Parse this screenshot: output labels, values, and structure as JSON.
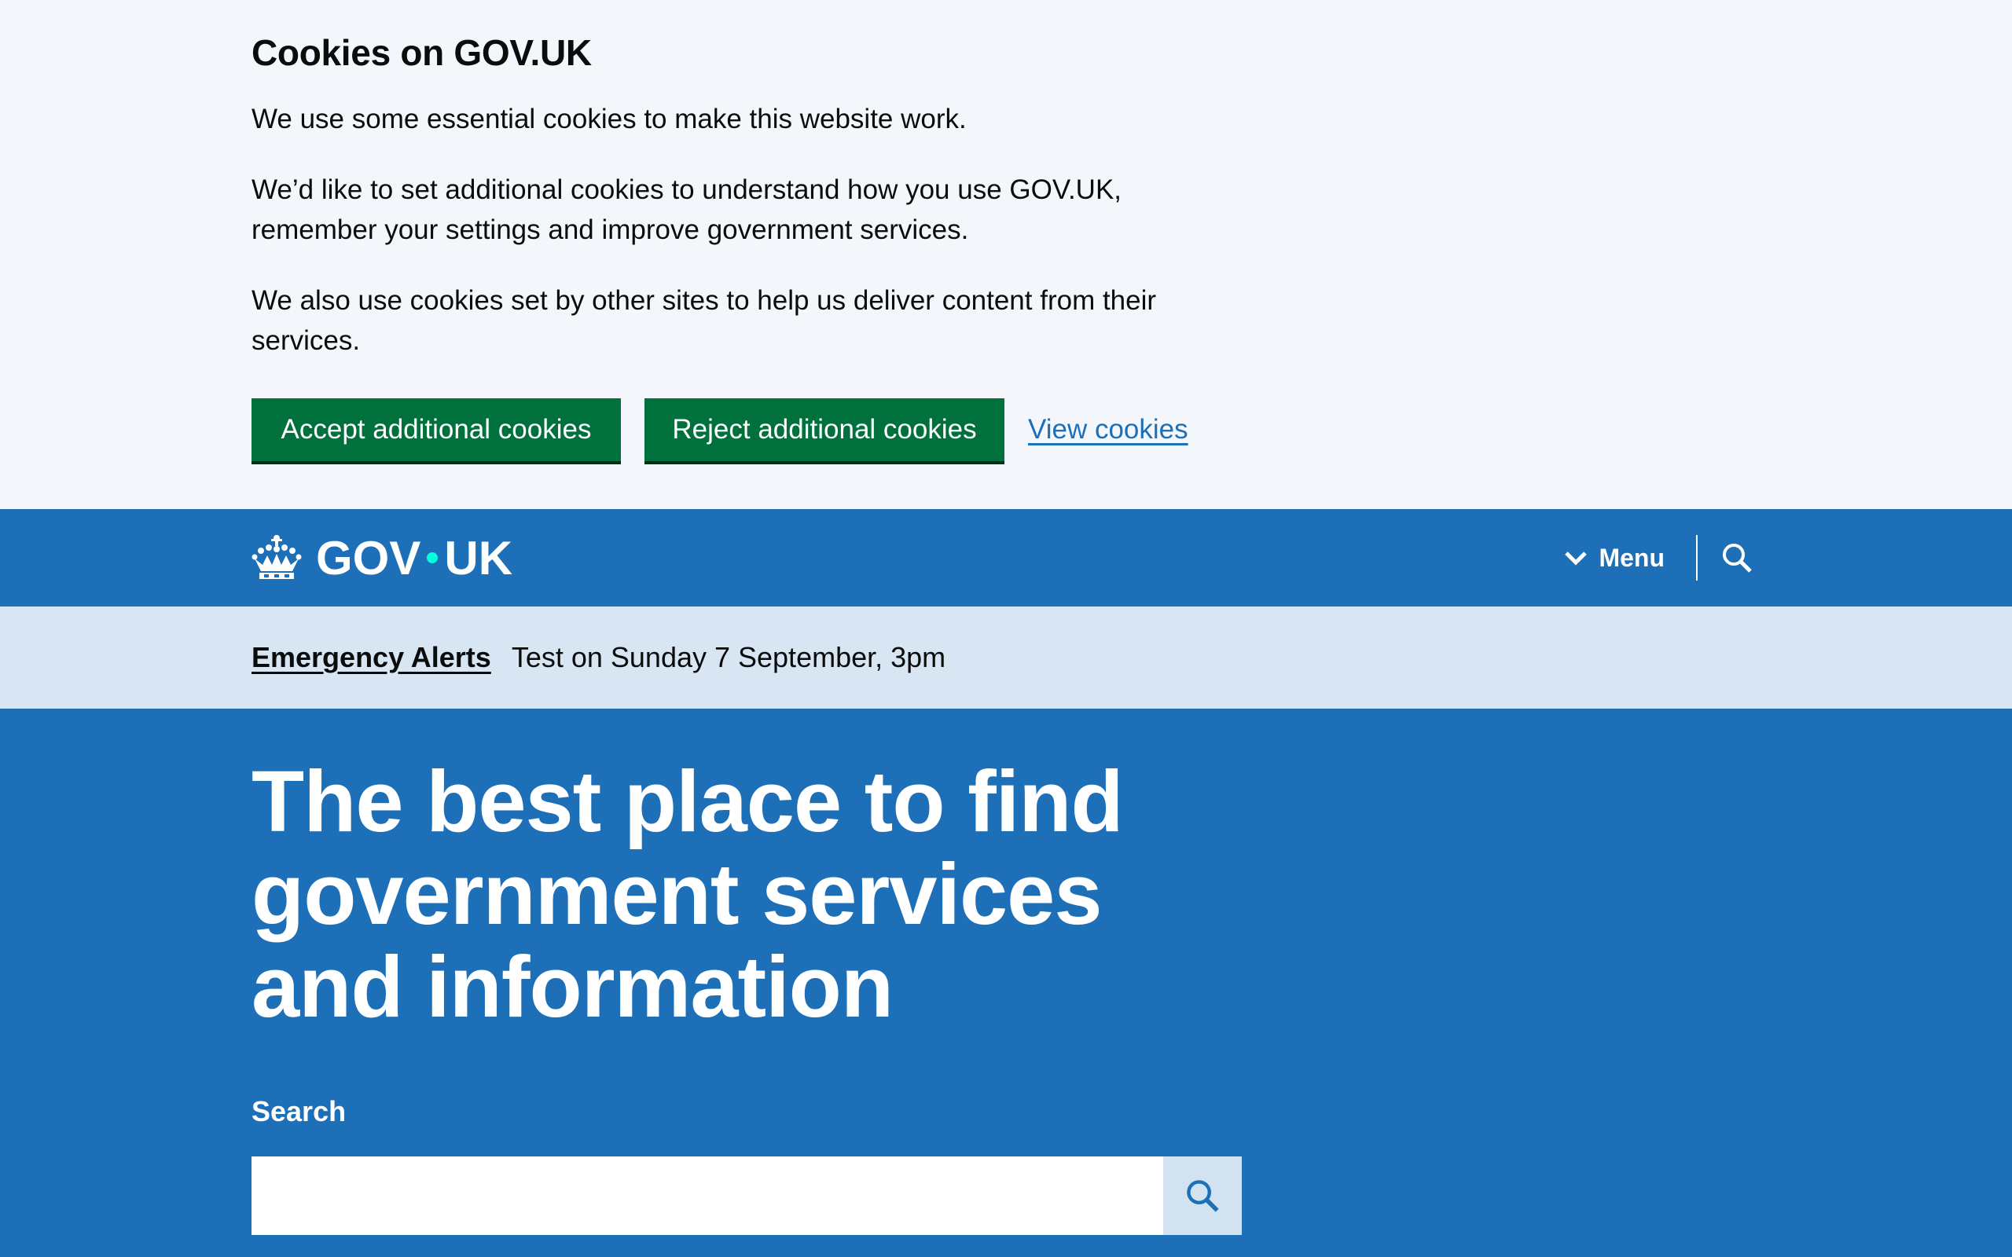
{
  "cookie_banner": {
    "title": "Cookies on GOV.UK",
    "paragraphs": [
      "We use some essential cookies to make this website work.",
      "We’d like to set additional cookies to understand how you use GOV.UK, remember your settings and improve government services.",
      "We also use cookies set by other sites to help us deliver content from their services."
    ],
    "accept_label": "Accept additional cookies",
    "reject_label": "Reject additional cookies",
    "view_label": "View cookies"
  },
  "header": {
    "logo_left": "GOV",
    "logo_right": "UK",
    "menu_label": "Menu",
    "icons": {
      "crown": "crown-icon",
      "chevron": "chevron-down-icon",
      "search": "search-icon"
    }
  },
  "alert": {
    "link_label": "Emergency Alerts",
    "text": "Test on Sunday 7 September, 3pm"
  },
  "hero": {
    "title": "The best place to find government services and information",
    "search_label": "Search",
    "search_value": ""
  },
  "colors": {
    "brand_blue": "#1d70b8",
    "button_green": "#00703c",
    "cookie_bg": "#f3f7fb",
    "alert_bg": "#d7e6f2",
    "logo_dot": "#00ffe0"
  }
}
